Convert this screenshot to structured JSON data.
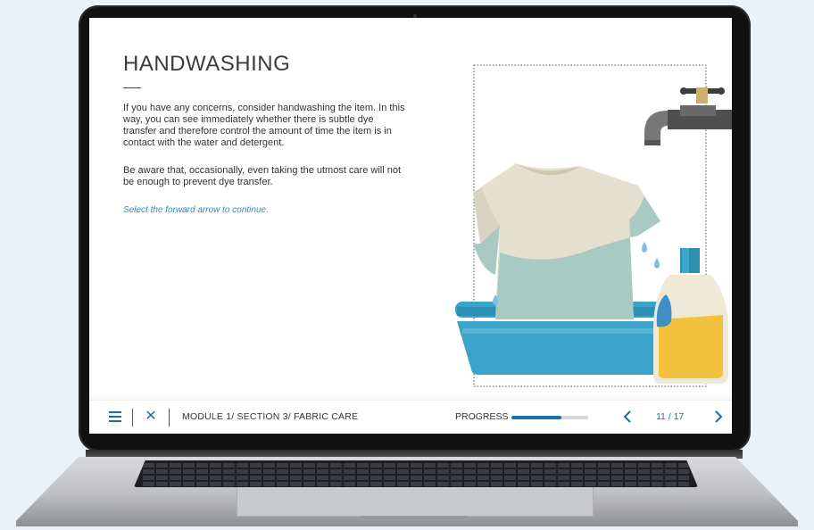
{
  "lesson": {
    "title": "HANDWASHING",
    "paragraphs": [
      "If you have any concerns, consider handwashing the item. In this way, you can see immediately whether there is subtle dye transfer and therefore control the amount of time the item is in contact with the water and detergent.",
      "Be aware that, occasionally, even taking the utmost care will not be enough to prevent dye transfer."
    ],
    "hint": "Select the forward arrow to continue."
  },
  "navbar": {
    "menu_icon": "hamburger-menu-icon",
    "close_icon": "close-icon",
    "close_glyph": "✕",
    "breadcrumb": "MODULE 1/ SECTION 3/ FABRIC CARE",
    "progress_label": "PROGRESS",
    "progress_value": 0.65,
    "page_counter": "11 / 17",
    "prev_icon": "chevron-left-icon",
    "next_icon": "chevron-right-icon"
  },
  "colors": {
    "accent": "#1a6fa8",
    "hint": "#2f8fbf",
    "basin": "#3aa3c9",
    "shirt": "#e4e0cf",
    "shirt_wet": "#a9c9c3",
    "detergent": "#f3c23c",
    "cap": "#2b8fb0"
  },
  "illustration": {
    "icons": [
      "faucet-icon",
      "tshirt-icon",
      "water-drop-icon",
      "basin-icon",
      "detergent-bottle-icon"
    ]
  }
}
